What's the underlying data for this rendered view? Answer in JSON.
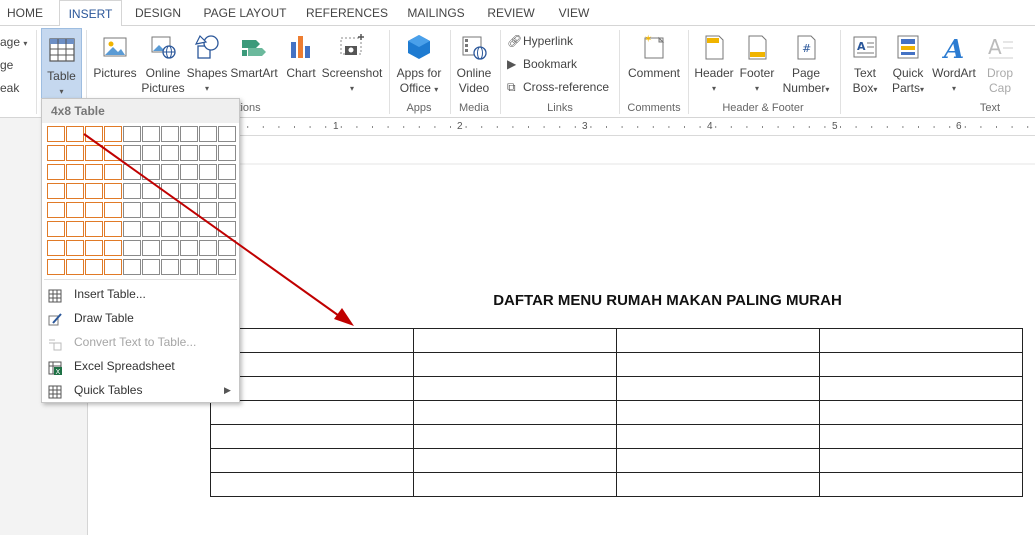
{
  "tabs": [
    {
      "label": "HOME",
      "active": false
    },
    {
      "label": "INSERT",
      "active": true
    },
    {
      "label": "DESIGN",
      "active": false
    },
    {
      "label": "PAGE LAYOUT",
      "active": false
    },
    {
      "label": "REFERENCES",
      "active": false
    },
    {
      "label": "MAILINGS",
      "active": false
    },
    {
      "label": "REVIEW",
      "active": false
    },
    {
      "label": "VIEW",
      "active": false
    }
  ],
  "ribbon": {
    "partial_left": [
      "age",
      "ge",
      "eak"
    ],
    "table": {
      "label": "Table"
    },
    "pictures": {
      "label": "Pictures"
    },
    "online_pictures": {
      "line1": "Online",
      "line2": "Pictures"
    },
    "shapes": {
      "label": "Shapes"
    },
    "smartart": {
      "label": "SmartArt"
    },
    "chart": {
      "label": "Chart"
    },
    "screenshot": {
      "label": "Screenshot"
    },
    "apps_for_office": {
      "line1": "Apps for",
      "line2": "Office"
    },
    "online_video": {
      "line1": "Online",
      "line2": "Video"
    },
    "hyperlink": {
      "label": "Hyperlink"
    },
    "bookmark": {
      "label": "Bookmark"
    },
    "cross_reference": {
      "label": "Cross-reference"
    },
    "comment": {
      "label": "Comment"
    },
    "header": {
      "label": "Header"
    },
    "footer": {
      "label": "Footer"
    },
    "page_number": {
      "line1": "Page",
      "line2": "Number"
    },
    "text_box": {
      "line1": "Text",
      "line2": "Box"
    },
    "quick_parts": {
      "line1": "Quick",
      "line2": "Parts"
    },
    "wordart": {
      "label": "WordArt"
    },
    "drop_cap": {
      "line1": "Drop",
      "line2": "Cap"
    },
    "groups": {
      "illustrations": "ations",
      "apps": "Apps",
      "media": "Media",
      "links": "Links",
      "comments": "Comments",
      "header_footer": "Header & Footer",
      "text": "Text"
    }
  },
  "ruler": {
    "numbers": [
      "1",
      "2",
      "3",
      "4",
      "5",
      "6"
    ]
  },
  "dropdown": {
    "title": "4x8 Table",
    "grid": {
      "cols": 10,
      "rows": 8,
      "selected_cols": 4,
      "selected_rows": 8
    },
    "items": [
      {
        "label": "Insert Table...",
        "enabled": true,
        "icon": "table-grid-icon",
        "has_submenu": false
      },
      {
        "label": "Draw Table",
        "enabled": true,
        "icon": "pencil-icon",
        "has_submenu": false
      },
      {
        "label": "Convert Text to Table...",
        "enabled": false,
        "icon": "convert-text-icon",
        "has_submenu": false
      },
      {
        "label": "Excel Spreadsheet",
        "enabled": true,
        "icon": "excel-icon",
        "has_submenu": false
      },
      {
        "label": "Quick Tables",
        "enabled": true,
        "icon": "table-grid-icon",
        "has_submenu": true
      }
    ]
  },
  "document": {
    "title": "DAFTAR MENU RUMAH MAKAN PALING MURAH",
    "table": {
      "cols": 4,
      "rows": 7
    }
  },
  "colors": {
    "accent": "#2b579a",
    "grid_highlight": "#e07a27",
    "annotation_arrow": "#c00000"
  }
}
